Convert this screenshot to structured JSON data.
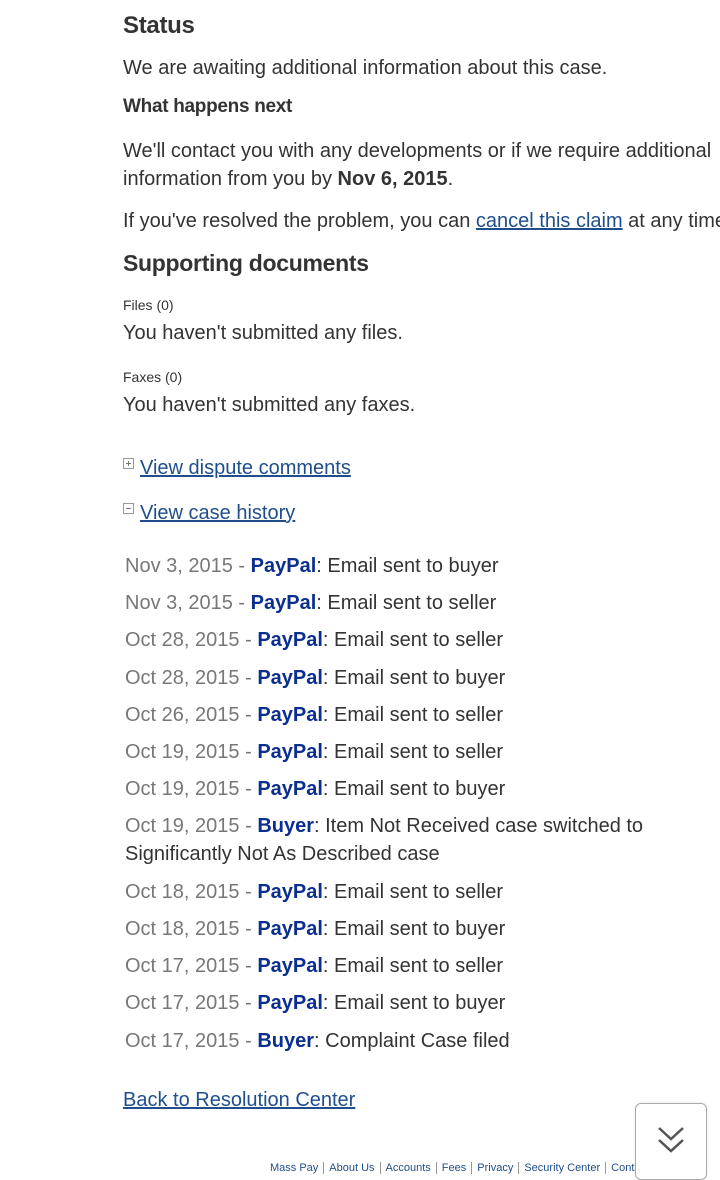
{
  "status": {
    "heading": "Status",
    "text": "We are awaiting additional information about this case."
  },
  "next": {
    "heading": "What happens next",
    "text_before": "We'll contact you with any developments or if we require additional information from you by ",
    "date": "Nov 6, 2015",
    "text_after": ".",
    "resolved_before": "If you've resolved the problem, you can ",
    "cancel_link": "cancel this claim",
    "resolved_after": " at any time."
  },
  "documents": {
    "heading": "Supporting documents",
    "files_label": "Files (0)",
    "files_text": "You haven't submitted any files.",
    "faxes_label": "Faxes (0)",
    "faxes_text": "You haven't submitted any faxes."
  },
  "toggles": {
    "comments": "View dispute comments",
    "history": "View case history"
  },
  "history": [
    {
      "date": "Nov 3, 2015",
      "sep": " - ",
      "actor": "PayPal",
      "text": ": Email sent to buyer"
    },
    {
      "date": "Nov 3, 2015",
      "sep": " - ",
      "actor": "PayPal",
      "text": ": Email sent to seller"
    },
    {
      "date": "Oct 28, 2015",
      "sep": " - ",
      "actor": "PayPal",
      "text": ": Email sent to seller"
    },
    {
      "date": "Oct 28, 2015",
      "sep": " - ",
      "actor": "PayPal",
      "text": ": Email sent to buyer"
    },
    {
      "date": "Oct 26, 2015",
      "sep": " - ",
      "actor": "PayPal",
      "text": ": Email sent to seller"
    },
    {
      "date": "Oct 19, 2015",
      "sep": " - ",
      "actor": "PayPal",
      "text": ": Email sent to seller"
    },
    {
      "date": "Oct 19, 2015",
      "sep": " - ",
      "actor": "PayPal",
      "text": ": Email sent to buyer"
    },
    {
      "date": "Oct 19, 2015",
      "sep": " - ",
      "actor": "Buyer",
      "text": ": Item Not Received case switched to Significantly Not As Described case"
    },
    {
      "date": "Oct 18, 2015",
      "sep": " - ",
      "actor": "PayPal",
      "text": ": Email sent to seller"
    },
    {
      "date": "Oct 18, 2015",
      "sep": " - ",
      "actor": "PayPal",
      "text": ": Email sent to buyer"
    },
    {
      "date": "Oct 17, 2015",
      "sep": " - ",
      "actor": "PayPal",
      "text": ": Email sent to seller"
    },
    {
      "date": "Oct 17, 2015",
      "sep": " - ",
      "actor": "PayPal",
      "text": ": Email sent to buyer"
    },
    {
      "date": "Oct 17, 2015",
      "sep": " - ",
      "actor": "Buyer",
      "text": ": Complaint Case filed"
    }
  ],
  "back_link": "Back to Resolution Center",
  "footer": {
    "links": [
      "Mass Pay",
      "About Us",
      "Accounts",
      "Fees",
      "Privacy",
      "Security Center",
      "Contact Us"
    ]
  },
  "scroll_button_icon": "double-chevron-down-icon"
}
